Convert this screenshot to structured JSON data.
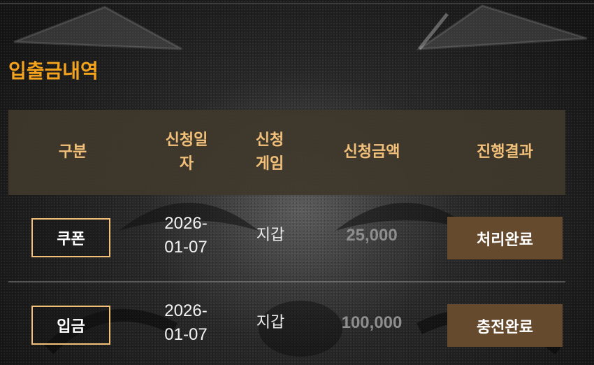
{
  "section": {
    "title": "입출금내역"
  },
  "table": {
    "headers": {
      "type": "구분",
      "date_line1": "신청일",
      "date_line2": "자",
      "game_line1": "신청",
      "game_line2": "게임",
      "amount": "신청금액",
      "result": "진행결과"
    },
    "rows": [
      {
        "type": "쿠폰",
        "date_line1": "2026-",
        "date_line2": "01-07",
        "game": "지갑",
        "amount": "25,000",
        "status": "처리완료"
      },
      {
        "type": "입금",
        "date_line1": "2026-",
        "date_line2": "01-07",
        "game": "지갑",
        "amount": "100,000",
        "status": "충전완료"
      }
    ]
  },
  "colors": {
    "title": "#f5a31c",
    "header_bg": "#3e382c",
    "header_text": "#f3c07a",
    "badge_border": "#f3c07a",
    "status_bg": "#664a2e",
    "amount_text": "#8e8e8e"
  }
}
